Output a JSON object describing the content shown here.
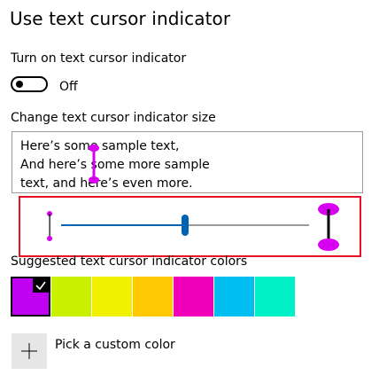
{
  "page": {
    "title": "Use text cursor indicator"
  },
  "toggle_section": {
    "label": "Turn on text cursor indicator",
    "state_text": "Off"
  },
  "size_section": {
    "label": "Change text cursor indicator size",
    "preview_lines": [
      "Here’s some sample text,",
      "And here’s some more sample",
      "text, and here’s even more."
    ],
    "slider_level_fraction": 0.5
  },
  "colors_section": {
    "label": "Suggested text cursor indicator colors",
    "swatches": [
      {
        "color": "#c000f0",
        "selected": true
      },
      {
        "color": "#c8f000",
        "selected": false
      },
      {
        "color": "#f0f000",
        "selected": false
      },
      {
        "color": "#ffc800",
        "selected": false
      },
      {
        "color": "#f000b8",
        "selected": false
      },
      {
        "color": "#00bef0",
        "selected": false
      },
      {
        "color": "#00f0c8",
        "selected": false
      }
    ],
    "custom_label": "Pick a custom color",
    "check_icon": "check-icon",
    "plus_icon": "plus-icon"
  },
  "colors": {
    "accent": "#0063b1",
    "indicator": "#d800f0",
    "highlight_border": "#e81123"
  }
}
